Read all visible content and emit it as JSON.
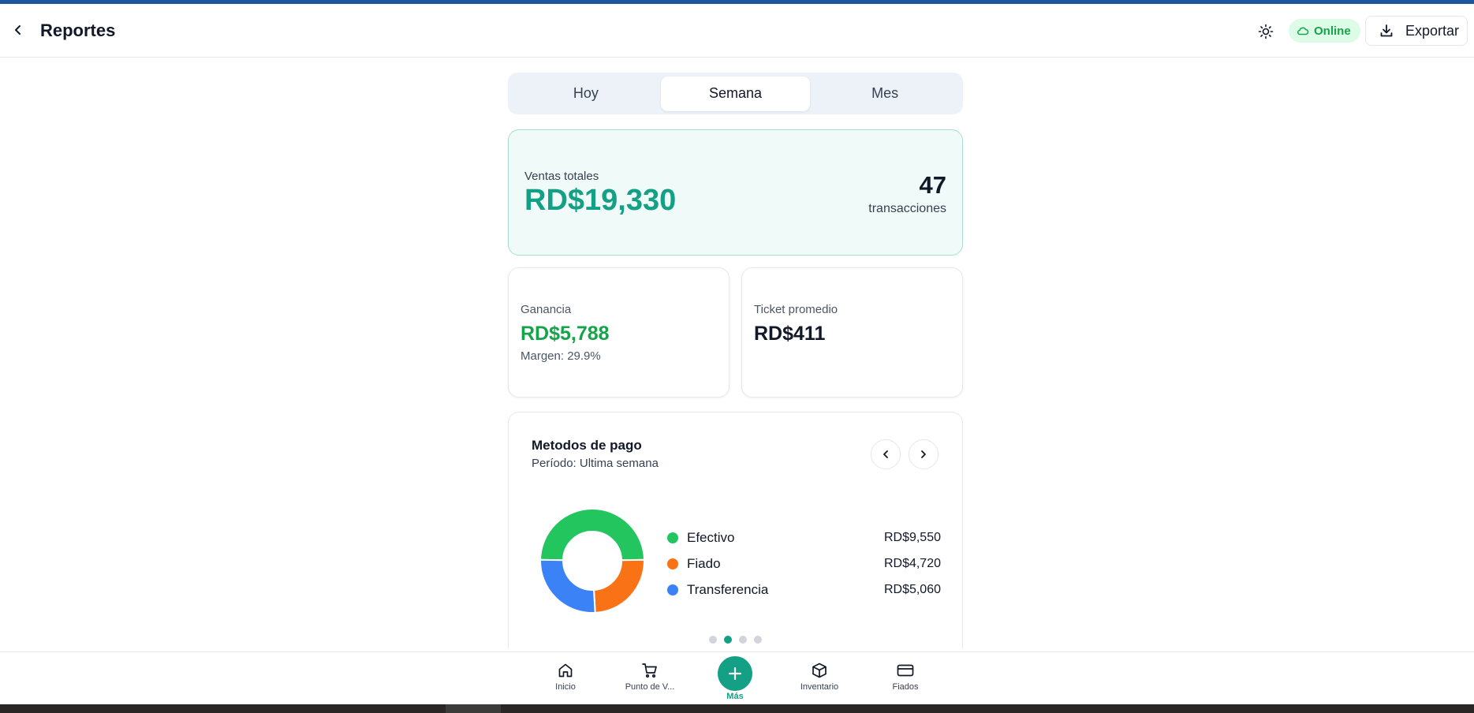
{
  "header": {
    "title": "Reportes",
    "status": "Online",
    "export_label": "Exportar"
  },
  "period_tabs": [
    {
      "label": "Hoy",
      "active": false
    },
    {
      "label": "Semana",
      "active": true
    },
    {
      "label": "Mes",
      "active": false
    }
  ],
  "summary": {
    "total_label": "Ventas totales",
    "total_value": "RD$19,330",
    "transactions_count": "47",
    "transactions_label": "transacciones"
  },
  "profit": {
    "label": "Ganancia",
    "value": "RD$5,788",
    "margin": "Margen: 29.9%"
  },
  "avg_ticket": {
    "label": "Ticket promedio",
    "value": "RD$411"
  },
  "payment_methods": {
    "title": "Metodos de pago",
    "subtitle": "Período: Ultima semana",
    "items": [
      {
        "name": "Efectivo",
        "value": "RD$9,550",
        "amount": 9550,
        "color": "#22c55e"
      },
      {
        "name": "Fiado",
        "value": "RD$4,720",
        "amount": 4720,
        "color": "#f97316"
      },
      {
        "name": "Transferencia",
        "value": "RD$5,060",
        "amount": 5060,
        "color": "#3b82f6"
      }
    ],
    "carousel_pages": 4,
    "carousel_active": 2
  },
  "bottom_nav": [
    {
      "label": "Inicio",
      "icon": "home-icon"
    },
    {
      "label": "Punto de V...",
      "icon": "cart-icon"
    },
    {
      "label": "Más",
      "icon": "plus-icon"
    },
    {
      "label": "Inventario",
      "icon": "box-icon"
    },
    {
      "label": "Fiados",
      "icon": "card-icon"
    }
  ],
  "colors": {
    "accent": "#14a085",
    "profit": "#16a34a",
    "online_bg": "#dcfce7"
  }
}
